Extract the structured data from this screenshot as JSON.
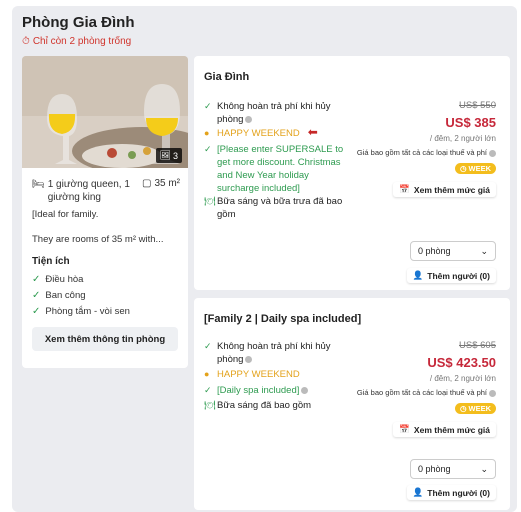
{
  "room": {
    "title": "Phòng Gia Đình",
    "availability": "Chỉ còn 2 phòng trống",
    "photo_count": "3",
    "beds": "1 giường queen, 1 giường king",
    "size": "35 m²",
    "description_line1": "[Ideal for family.",
    "description_line2": "They are rooms of 35 m² with...",
    "amenities_title": "Tiện ích",
    "amenities": [
      "Điều hòa",
      "Ban công",
      "Phòng tắm - vòi sen"
    ],
    "more_info_label": "Xem thêm thông tin phòng"
  },
  "rates": [
    {
      "name": "Gia Đình",
      "features": [
        {
          "type": "check",
          "text": "Không hoàn trả phí khi hủy phòng"
        },
        {
          "type": "deal",
          "text": "HAPPY WEEKEND"
        },
        {
          "type": "check",
          "text": "[Please enter SUPERSALE to get more discount. Christmas and New Year holiday surcharge included]"
        },
        {
          "type": "meal",
          "text": "Bữa sáng và bữa trưa đã bao gồm"
        }
      ],
      "old_price": "US$ 550",
      "price": "US$ 385",
      "per": "/ đêm, 2 người lớn",
      "tax_note": "Giá bao gồm tất cả các loại thuế và phí",
      "badge": "WEEK",
      "price_link": "Xem thêm mức giá",
      "rooms_select": "0 phòng",
      "guests_button": "Thêm người (0)"
    },
    {
      "name": "[Family 2 | Daily spa included]",
      "features": [
        {
          "type": "check",
          "text": "Không hoàn trả phí khi hủy phòng"
        },
        {
          "type": "deal",
          "text": "HAPPY WEEKEND"
        },
        {
          "type": "check",
          "text": "[Daily spa included]"
        },
        {
          "type": "meal",
          "text": "Bữa sáng đã bao gồm"
        }
      ],
      "old_price": "US$ 605",
      "price": "US$ 423.50",
      "per": "/ đêm, 2 người lớn",
      "tax_note": "Giá bao gồm tất cả các loại thuế và phí",
      "badge": "WEEK",
      "price_link": "Xem thêm mức giá",
      "rooms_select": "0 phòng",
      "guests_button": "Thêm người (0)"
    }
  ],
  "colors": {
    "price": "#c6283a",
    "availability": "#d0342c",
    "check": "#2e9b50",
    "deal": "#e3a21b",
    "badge": "#f3bd1d"
  }
}
